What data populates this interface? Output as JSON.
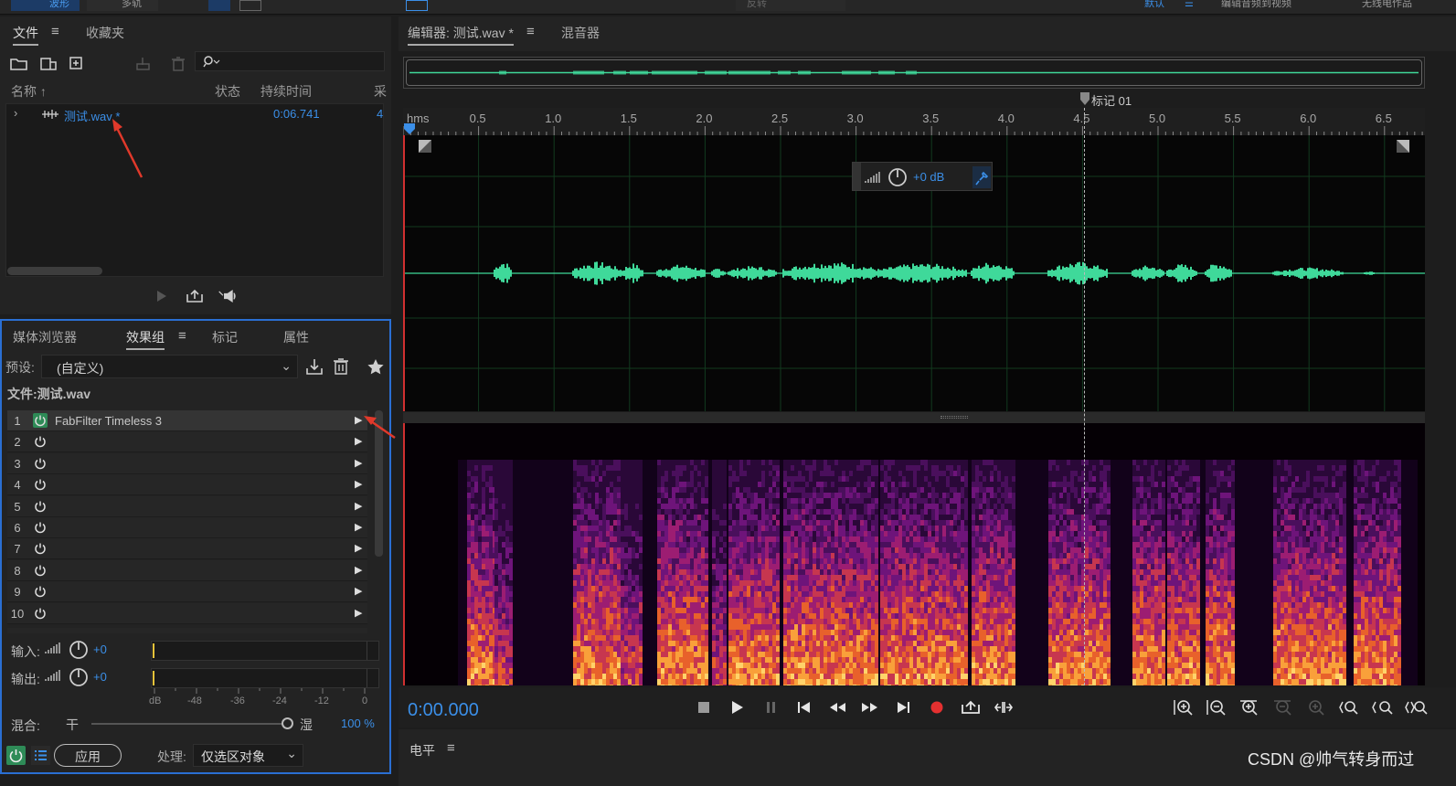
{
  "topbar": {
    "workspace_tabs": [
      "波形",
      "多轨"
    ],
    "edit_label": "反转",
    "right_items": [
      "默认",
      "编辑音频到视频",
      "无线电作品"
    ]
  },
  "files_panel": {
    "tabs": [
      "文件",
      "收藏夹"
    ],
    "columns": [
      "名称",
      "状态",
      "持续时间",
      "采"
    ],
    "file": {
      "name": "测试.wav *",
      "duration": "0:06.741",
      "rate_partial": "4"
    }
  },
  "effects_panel": {
    "tabs": [
      "媒体浏览器",
      "效果组",
      "标记",
      "属性"
    ],
    "preset_label": "预设:",
    "preset_value": "(自定义)",
    "file_label": "文件:测试.wav",
    "rack": [
      {
        "num": "1",
        "name": "FabFilter Timeless 3",
        "enabled": true
      },
      {
        "num": "2",
        "name": ""
      },
      {
        "num": "3",
        "name": ""
      },
      {
        "num": "4",
        "name": ""
      },
      {
        "num": "5",
        "name": ""
      },
      {
        "num": "6",
        "name": ""
      },
      {
        "num": "7",
        "name": ""
      },
      {
        "num": "8",
        "name": ""
      },
      {
        "num": "9",
        "name": ""
      },
      {
        "num": "10",
        "name": ""
      }
    ],
    "input_label": "输入:",
    "input_value": "+0",
    "output_label": "输出:",
    "output_value": "+0",
    "meter_scale": [
      "dB",
      "-48",
      "-36",
      "-24",
      "-12",
      "0"
    ],
    "mix_label": "混合:",
    "mix_dry": "干",
    "mix_wet": "湿",
    "mix_value": "100 %",
    "apply_label": "应用",
    "process_label": "处理:",
    "process_value": "仅选区对象"
  },
  "editor": {
    "tab_editor": "编辑器: 测试.wav *",
    "tab_mixer": "混音器",
    "marker_label": "标记 01",
    "ruler_labels": [
      "hms",
      "0.5",
      "1.0",
      "1.5",
      "2.0",
      "2.5",
      "3.0",
      "3.5",
      "4.0",
      "4.5",
      "5.0",
      "5.5",
      "6.0",
      "6.5"
    ],
    "hud_gain": "+0 dB",
    "timecode": "0:00.000",
    "level_tab": "电平",
    "waveform_color": "#3fd99a",
    "accent_color": "#3b8fe8"
  },
  "watermark": "CSDN @帅气转身而过"
}
